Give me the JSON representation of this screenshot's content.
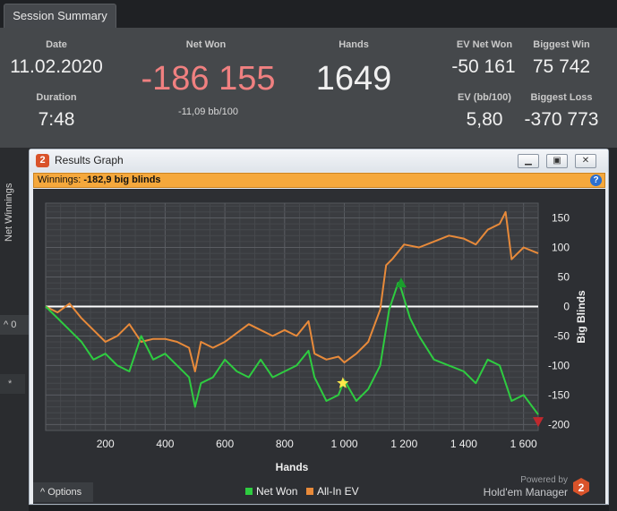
{
  "tab": {
    "label": "Session Summary"
  },
  "summary": {
    "date_label": "Date",
    "date_value": "11.02.2020",
    "duration_label": "Duration",
    "duration_value": "7:48",
    "net_won_label": "Net Won",
    "net_won_value": "-186 155",
    "net_won_bb": "-11,09 bb/100",
    "hands_label": "Hands",
    "hands_value": "1649",
    "ev_net_won_label": "EV Net Won",
    "ev_net_won_value": "-50 161",
    "ev_bb_label": "EV (bb/100)",
    "ev_bb_value": "5,80",
    "biggest_win_label": "Biggest Win",
    "biggest_win_value": "75 742",
    "biggest_loss_label": "Biggest Loss",
    "biggest_loss_value": "-370 773"
  },
  "sidebar": {
    "vertical_label": "Net Winnings",
    "tab_label": "^ 0",
    "star": "*"
  },
  "window": {
    "title": "Results Graph",
    "logo_text": "2",
    "buttons": [
      "minimize-icon",
      "restore-icon",
      "close-icon"
    ],
    "info_prefix": "Winnings:",
    "info_value": "-182,9 big blinds",
    "help_icon": "?",
    "options_label": "^ Options",
    "powered_by": "Powered by",
    "brand": "Hold'em Manager",
    "brand_logo": "2"
  },
  "colors": {
    "net_won": "#2ecc40",
    "all_in_ev": "#e88a3a",
    "zero_line": "#ffffff",
    "accent": "#f5a83c"
  },
  "chart_data": {
    "type": "line",
    "xlabel": "Hands",
    "ylabel": "Big Blinds",
    "xlim": [
      0,
      1649
    ],
    "ylim": [
      -210,
      175
    ],
    "x_ticks": [
      "200",
      "400",
      "600",
      "800",
      "1 000",
      "1 200",
      "1 400",
      "1 600"
    ],
    "y_ticks": [
      "150",
      "100",
      "50",
      "0",
      "-50",
      "-100",
      "-150",
      "-200"
    ],
    "grid": true,
    "legend": "bottom-center",
    "series": [
      {
        "name": "Net Won",
        "x": [
          0,
          40,
          80,
          120,
          160,
          200,
          240,
          280,
          320,
          360,
          400,
          440,
          480,
          500,
          520,
          560,
          600,
          640,
          680,
          720,
          760,
          800,
          840,
          880,
          900,
          940,
          980,
          1000,
          1040,
          1080,
          1120,
          1150,
          1180,
          1190,
          1220,
          1250,
          1300,
          1350,
          1400,
          1440,
          1480,
          1520,
          1560,
          1600,
          1649
        ],
        "y": [
          0,
          -20,
          -40,
          -60,
          -90,
          -80,
          -100,
          -110,
          -50,
          -90,
          -80,
          -100,
          -120,
          -170,
          -130,
          -120,
          -90,
          -110,
          -120,
          -90,
          -120,
          -110,
          -100,
          -75,
          -120,
          -160,
          -150,
          -125,
          -160,
          -140,
          -100,
          -5,
          40,
          30,
          -20,
          -50,
          -90,
          -100,
          -110,
          -130,
          -90,
          -100,
          -160,
          -150,
          -183
        ]
      },
      {
        "name": "All-In EV",
        "x": [
          0,
          40,
          80,
          120,
          160,
          200,
          240,
          280,
          320,
          360,
          400,
          440,
          480,
          500,
          520,
          560,
          600,
          640,
          680,
          720,
          760,
          800,
          840,
          880,
          900,
          940,
          980,
          1000,
          1040,
          1080,
          1120,
          1140,
          1160,
          1200,
          1250,
          1300,
          1350,
          1400,
          1440,
          1480,
          1520,
          1540,
          1560,
          1600,
          1649
        ],
        "y": [
          0,
          -10,
          5,
          -20,
          -40,
          -60,
          -50,
          -30,
          -60,
          -55,
          -55,
          -60,
          -70,
          -110,
          -60,
          -70,
          -60,
          -45,
          -30,
          -40,
          -50,
          -40,
          -50,
          -25,
          -80,
          -90,
          -85,
          -95,
          -80,
          -60,
          -5,
          70,
          80,
          105,
          100,
          110,
          120,
          115,
          105,
          130,
          140,
          160,
          80,
          100,
          90
        ]
      }
    ],
    "markers": [
      {
        "type": "star",
        "x": 995,
        "y": -130
      },
      {
        "type": "peak",
        "x": 1190,
        "y": 40
      },
      {
        "type": "trough",
        "x": 1649,
        "y": -195
      }
    ]
  }
}
